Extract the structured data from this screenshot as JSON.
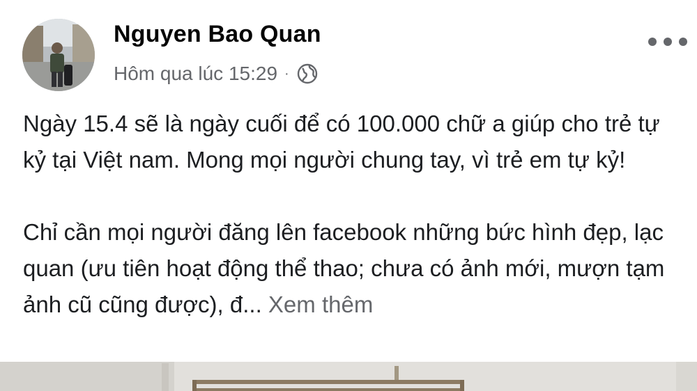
{
  "post": {
    "author": "Nguyen Bao Quan",
    "timestamp": "Hôm qua lúc 15:29",
    "separator": "·",
    "privacy_icon": "globe-icon",
    "menu_icon": "more-options-icon",
    "paragraphs": [
      "Ngày 15.4 sẽ là ngày cuối để có 100.000 chữ a giúp cho trẻ tự kỷ tại Việt nam. Mong mọi người chung tay, vì trẻ em tự kỷ!",
      "Chỉ cần mọi người đăng lên facebook những bức hình đẹp, lạc quan (ưu tiên hoạt động thể thao; chưa có ảnh mới, mượn tạm ảnh cũ cũng được), đ..."
    ],
    "see_more_label": "Xem thêm"
  },
  "colors": {
    "text_primary": "#050505",
    "text_secondary": "#65676b",
    "background": "#ffffff"
  }
}
